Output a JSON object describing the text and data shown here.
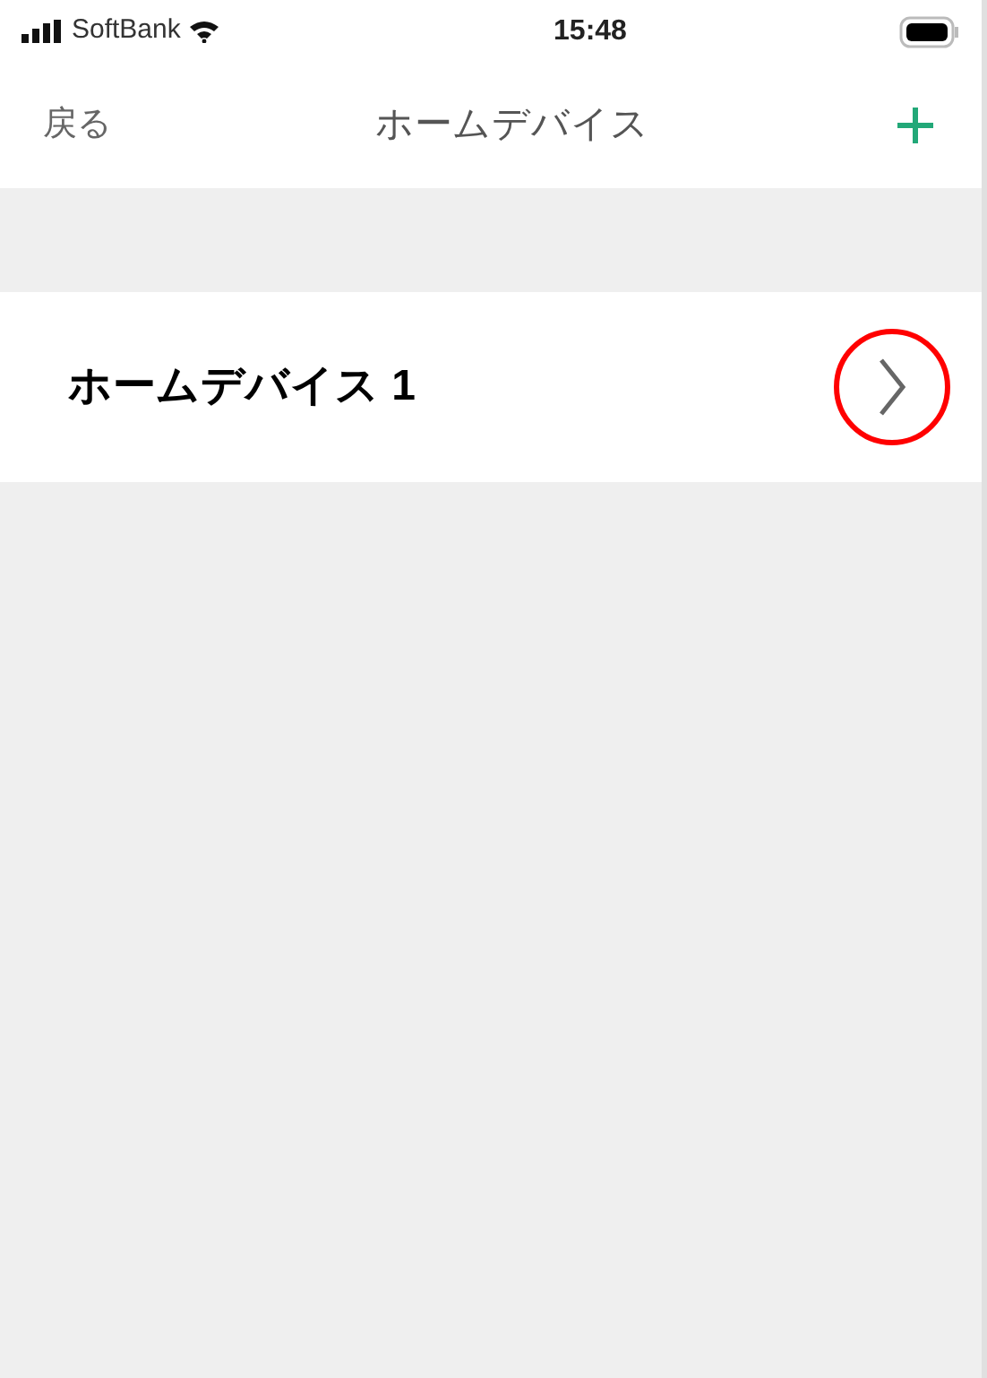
{
  "status_bar": {
    "carrier": "SoftBank",
    "time": "15:48"
  },
  "nav": {
    "back": "戻る",
    "title": "ホームデバイス"
  },
  "devices": [
    {
      "label": "ホームデバイス 1",
      "highlighted": true
    }
  ]
}
